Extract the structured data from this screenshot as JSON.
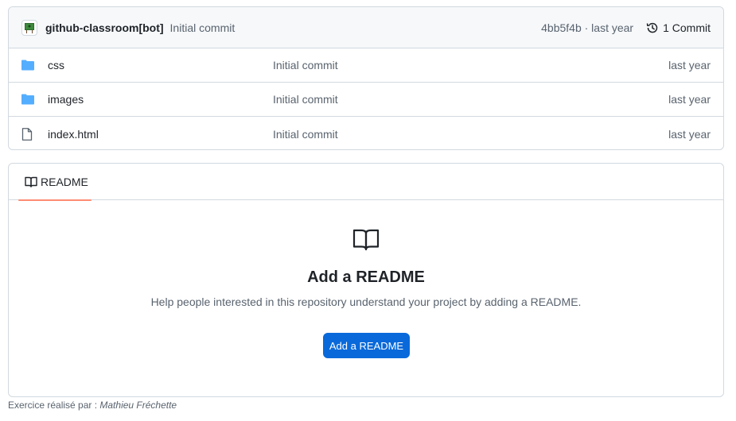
{
  "commit_header": {
    "author": "github-classroom[bot]",
    "message": "Initial commit",
    "sha_time": "4bb5f4b · last year",
    "commits_label": "1 Commit"
  },
  "files": [
    {
      "type": "folder",
      "icon": "folder-icon",
      "name": "css",
      "commit": "Initial commit",
      "time": "last year"
    },
    {
      "type": "folder",
      "icon": "folder-icon",
      "name": "images",
      "commit": "Initial commit",
      "time": "last year"
    },
    {
      "type": "file",
      "icon": "file-icon",
      "name": "index.html",
      "commit": "Initial commit",
      "time": "last year"
    }
  ],
  "readme": {
    "tab_label": "README",
    "title": "Add a README",
    "description": "Help people interested in this repository understand your project by adding a README.",
    "button_label": "Add a README"
  },
  "footer": {
    "prefix": "Exercice réalisé par : ",
    "author": "Mathieu Fréchette"
  },
  "colors": {
    "folder": "#54aeff",
    "accent": "#0969da",
    "tab_underline": "#fd8c73"
  }
}
